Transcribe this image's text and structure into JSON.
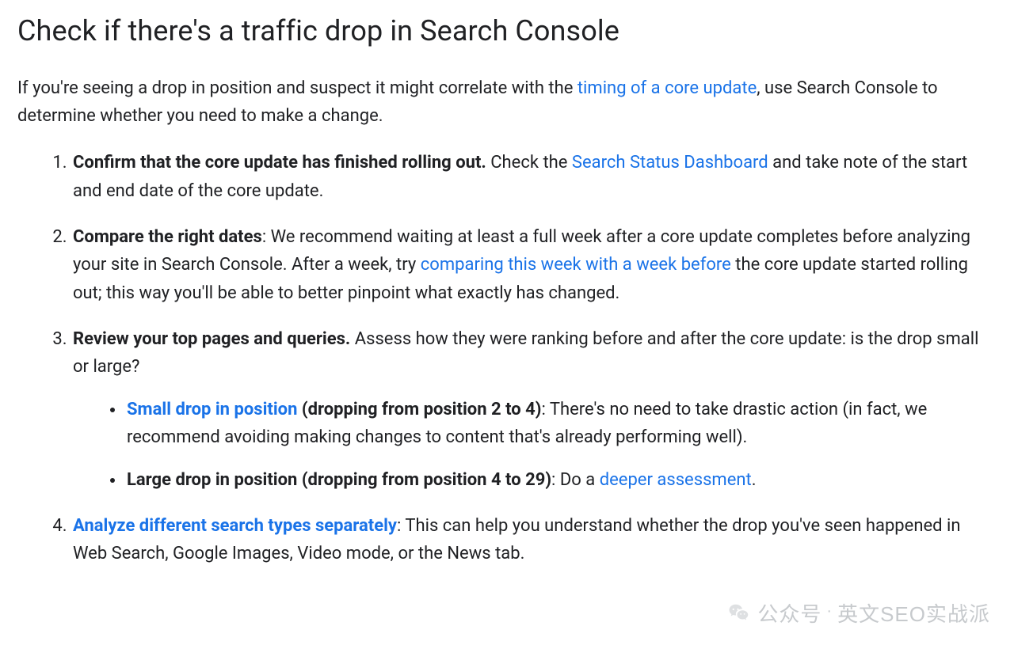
{
  "title": "Check if there's a traffic drop in Search Console",
  "intro": {
    "before_link": "If you're seeing a drop in position and suspect it might correlate with the ",
    "link": "timing of a core update",
    "after_link": ", use Search Console to determine whether you need to make a change."
  },
  "steps": {
    "s1": {
      "lead": "Confirm that the core update has finished rolling out.",
      "before_link": " Check the ",
      "link": "Search Status Dashboard",
      "after_link": " and take note of the start and end date of the core update."
    },
    "s2": {
      "lead": "Compare the right dates",
      "before_link": ": We recommend waiting at least a full week after a core update completes before analyzing your site in Search Console. After a week, try ",
      "link": "comparing this week with a week before",
      "after_link": " the core update started rolling out; this way you'll be able to better pinpoint what exactly has changed."
    },
    "s3": {
      "lead": "Review your top pages and queries.",
      "tail": " Assess how they were ranking before and after the core update: is the drop small or large?",
      "small": {
        "link": "Small drop in position",
        "bold_tail": " (dropping from position 2 to 4)",
        "rest": ": There's no need to take drastic action (in fact, we recommend avoiding making changes to content that's already performing well)."
      },
      "large": {
        "bold": "Large drop in position (dropping from position 4 to 29)",
        "before_link": ": Do a ",
        "link": "deeper assessment",
        "after_link": "."
      }
    },
    "s4": {
      "lead_link": "Analyze different search types separately",
      "tail": ": This can help you understand whether the drop you've seen happened in Web Search, Google Images, Video mode, or the News tab."
    }
  },
  "watermark": {
    "left": "公众号",
    "right": "英文SEO实战派"
  }
}
